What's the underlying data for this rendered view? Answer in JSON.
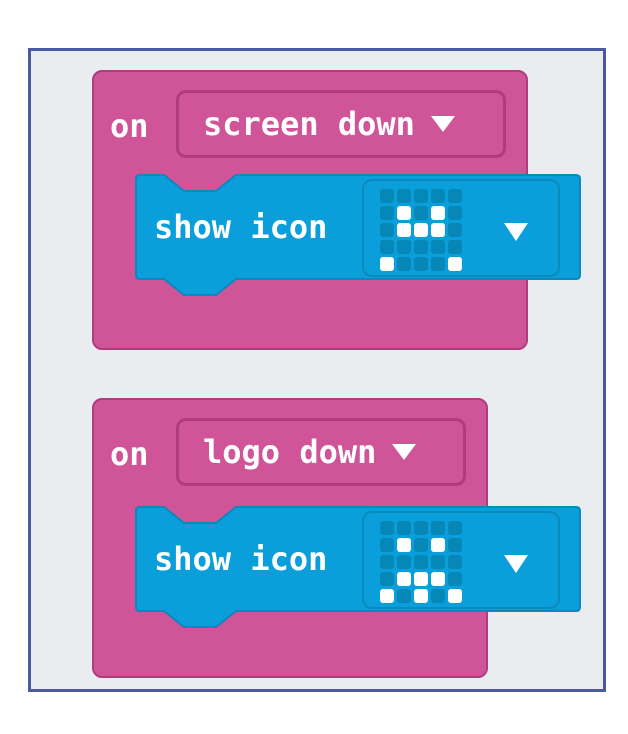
{
  "events": [
    {
      "label": "on",
      "gesture": "screen down",
      "statement": {
        "label": "show icon",
        "leds": [
          [
            0,
            0,
            0,
            0,
            0
          ],
          [
            0,
            1,
            0,
            1,
            0
          ],
          [
            0,
            1,
            1,
            1,
            0
          ],
          [
            0,
            0,
            0,
            0,
            0
          ],
          [
            1,
            0,
            0,
            0,
            1
          ]
        ]
      }
    },
    {
      "label": "on",
      "gesture": "logo down",
      "statement": {
        "label": "show icon",
        "leds": [
          [
            0,
            0,
            0,
            0,
            0
          ],
          [
            0,
            1,
            0,
            1,
            0
          ],
          [
            0,
            0,
            0,
            0,
            0
          ],
          [
            0,
            1,
            1,
            1,
            0
          ],
          [
            1,
            0,
            1,
            0,
            1
          ]
        ]
      }
    }
  ],
  "colors": {
    "workspace": "#e9edf0",
    "border": "#4a5aa1",
    "event_block": "#cf5498",
    "basic_block": "#0a9fda"
  },
  "icons": {
    "dropdown": "triangle-down-icon"
  }
}
